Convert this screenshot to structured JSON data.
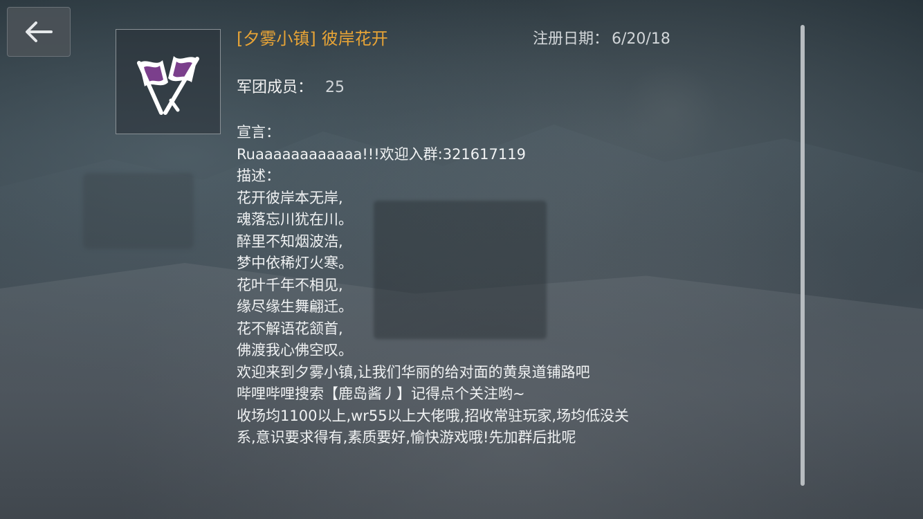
{
  "header": {
    "back_icon": "arrow-left-icon",
    "guild_tag": "[夕雾小镇]",
    "guild_name": "彼岸花开",
    "reg_label": "注册日期：",
    "reg_date": "6/20/18"
  },
  "emblem": {
    "icon": "crossed-flags-emblem-icon",
    "colors": {
      "flag_fill": "#7b3f8c",
      "flag_outline": "#ffffff"
    }
  },
  "info": {
    "members_label": "军团成员：",
    "members_value": "25"
  },
  "content": {
    "lines": [
      "宣言：",
      "Ruaaaaaaaaaaaa!!!欢迎入群:321617119",
      "描述：",
      "花开彼岸本无岸,",
      "魂落忘川犹在川。",
      "醉里不知烟波浩,",
      "梦中依稀灯火寒。",
      "花叶千年不相见,",
      "缘尽缘生舞翩迁。",
      "花不解语花颔首,",
      "佛渡我心佛空叹。",
      "欢迎来到夕雾小镇,让我们华丽的给对面的黄泉道铺路吧",
      "哔哩哔哩搜索【鹿岛酱丿】记得点个关注哟~",
      "收场均1100以上,wr55以上大佬哦,招收常驻玩家,场均低没关",
      "系,意识要求得有,素质要好,愉快游戏哦!先加群后批呢"
    ]
  },
  "colors": {
    "accent": "#e8a436",
    "text": "#f0f2f3",
    "muted": "#d2d6d9"
  }
}
